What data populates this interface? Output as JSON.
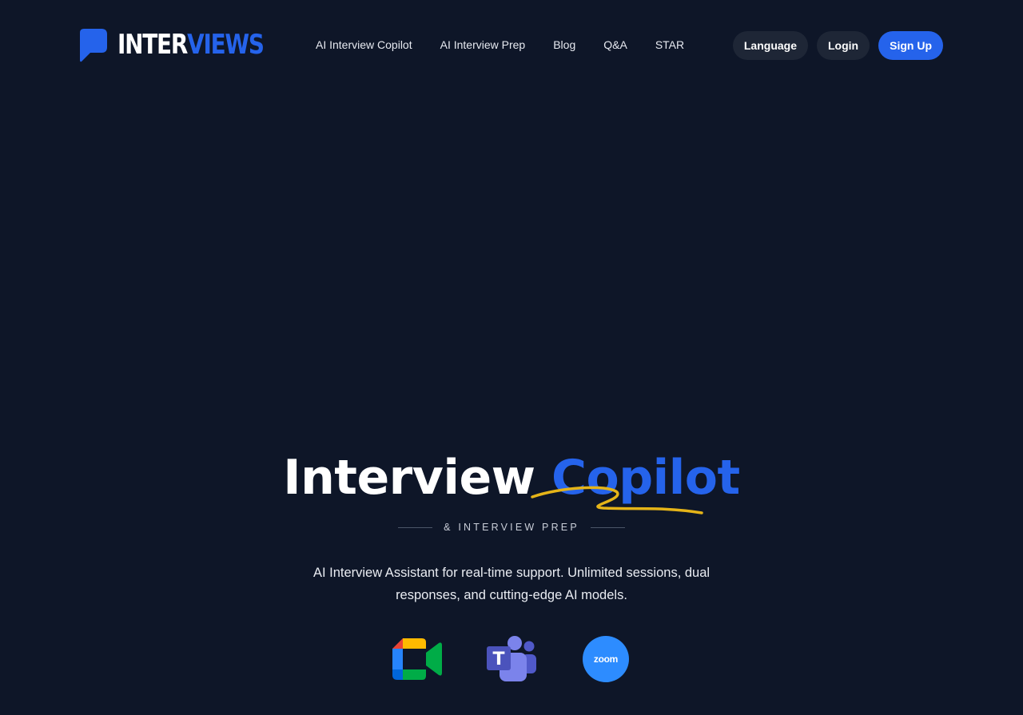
{
  "header": {
    "logo": {
      "text_white": "INTER",
      "text_blue": "VIEWS"
    },
    "nav": [
      {
        "label": "AI Interview Copilot"
      },
      {
        "label": "AI Interview Prep"
      },
      {
        "label": "Blog"
      },
      {
        "label": "Q&A"
      },
      {
        "label": "STAR"
      }
    ],
    "actions": {
      "language": "Language",
      "login": "Login",
      "signup": "Sign Up"
    }
  },
  "hero": {
    "title_main": "Interview",
    "title_accent": "Copilot",
    "subtitle": "& INTERVIEW PREP",
    "description": "AI Interview Assistant for real-time support. Unlimited sessions, dual responses, and cutting-edge AI models."
  },
  "apps": {
    "meet_icon": "google-meet-icon",
    "teams_icon": "microsoft-teams-icon",
    "teams_letter": "T",
    "zoom_icon": "zoom-icon",
    "zoom_label": "zoom"
  },
  "colors": {
    "background": "#0e1628",
    "accent": "#2563eb",
    "button_dark": "#1e2636",
    "swoosh": "#e5b418",
    "zoom": "#2d8cff"
  }
}
